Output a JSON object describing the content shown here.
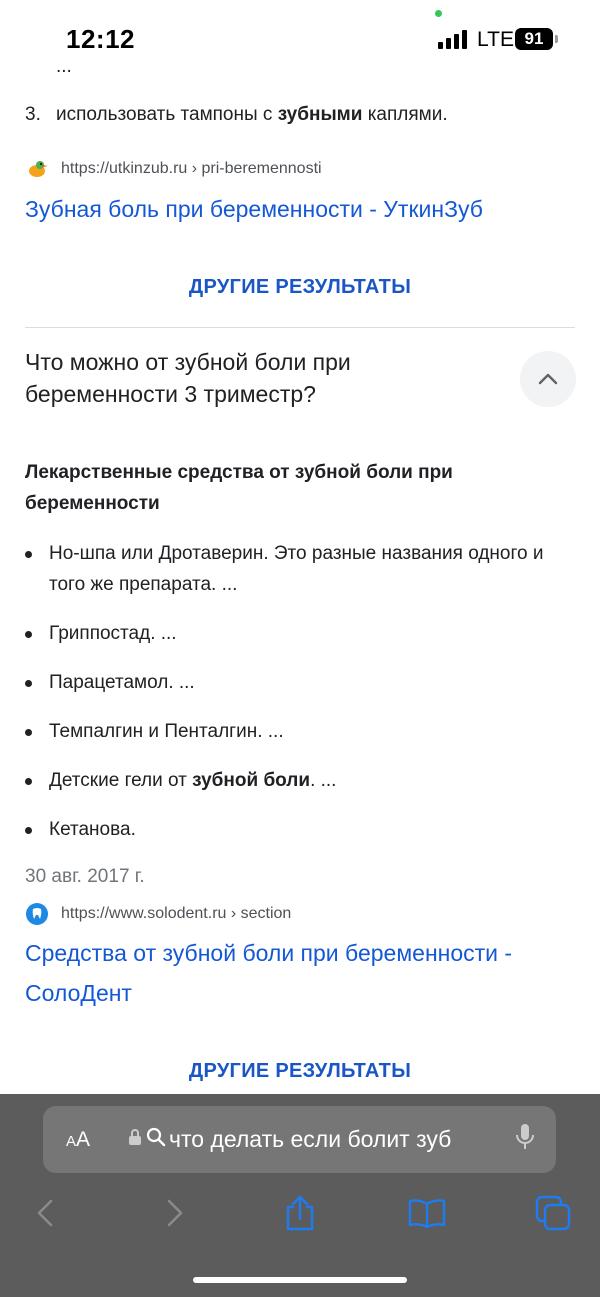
{
  "status_bar": {
    "time": "12:12",
    "network": "LTE",
    "battery": "91"
  },
  "prev_result": {
    "ellipsis": "...",
    "list_item_number": "3.",
    "list_item_text_before": "использовать тампоны с ",
    "list_item_text_bold": "зубными",
    "list_item_text_after": " каплями.",
    "source_url": "https://utkinzub.ru › pri-beremennosti",
    "title": "Зубная боль при беременности - УткинЗуб"
  },
  "more_results_label": "ДРУГИЕ РЕЗУЛЬТАТЫ",
  "question": {
    "text": "Что можно от зубной боли при беременности 3 триместр?",
    "snippet_heading": "Лекарственные средства от зубной боли при беременности",
    "bullets": [
      {
        "before": "Но-шпа или Дротаверин. Это разные названия одного и того же препарата. ...",
        "bold": "",
        "after": ""
      },
      {
        "before": "Гриппостад. ...",
        "bold": "",
        "after": ""
      },
      {
        "before": "Парацетамол. ...",
        "bold": "",
        "after": ""
      },
      {
        "before": "Темпалгин и Пенталгин. ...",
        "bold": "",
        "after": ""
      },
      {
        "before": "Детские гели от ",
        "bold": "зубной боли",
        "after": ". ..."
      },
      {
        "before": "Кетанова.",
        "bold": "",
        "after": ""
      }
    ],
    "date": "30 авг. 2017 г.",
    "source_url": "https://www.solodent.ru › section",
    "title_line1": "Средства от зубной боли при беременности -",
    "title_line2": "СолоДент",
    "more_results_label": "ДРУГИЕ РЕЗУЛЬТАТЫ"
  },
  "browser": {
    "aa_label_small": "A",
    "aa_label_large": "A",
    "address_text": "что делать если болит зуб",
    "icons": [
      "back-icon",
      "forward-icon",
      "share-icon",
      "bookmarks-icon",
      "tabs-icon"
    ]
  }
}
